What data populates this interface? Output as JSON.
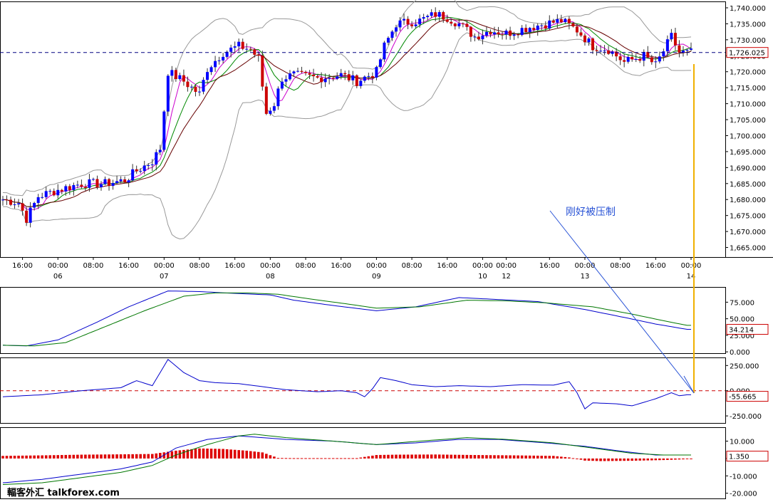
{
  "chart_data": [
    {
      "panel": "price",
      "type": "candlestick",
      "ylim": [
        1662,
        1742
      ],
      "y_ticks": [
        "1,740.000",
        "1,735.000",
        "1,730.000",
        "1,725.000",
        "1,720.000",
        "1,715.000",
        "1,710.000",
        "1,705.000",
        "1,700.000",
        "1,695.000",
        "1,690.000",
        "1,685.000",
        "1,680.000",
        "1,675.000",
        "1,670.000",
        "1,665.000"
      ],
      "y_tick_values": [
        1740,
        1735,
        1730,
        1725,
        1720,
        1715,
        1710,
        1705,
        1700,
        1695,
        1690,
        1685,
        1680,
        1675,
        1670,
        1665
      ],
      "x_ticks": [
        {
          "bar": 5,
          "time": "16:00",
          "day": ""
        },
        {
          "bar": 14,
          "time": "00:00",
          "day": "06"
        },
        {
          "bar": 23,
          "time": "08:00",
          "day": ""
        },
        {
          "bar": 32,
          "time": "16:00",
          "day": ""
        },
        {
          "bar": 41,
          "time": "00:00",
          "day": "07"
        },
        {
          "bar": 50,
          "time": "08:00",
          "day": ""
        },
        {
          "bar": 59,
          "time": "16:00",
          "day": ""
        },
        {
          "bar": 68,
          "time": "00:00",
          "day": "08"
        },
        {
          "bar": 77,
          "time": "08:00",
          "day": ""
        },
        {
          "bar": 86,
          "time": "16:00",
          "day": ""
        },
        {
          "bar": 95,
          "time": "00:00",
          "day": "09"
        },
        {
          "bar": 104,
          "time": "08:00",
          "day": ""
        },
        {
          "bar": 113,
          "time": "16:00",
          "day": ""
        },
        {
          "bar": 122,
          "time": "00:00",
          "day": "10"
        },
        {
          "bar": 128,
          "time": "00:00",
          "day": "12"
        },
        {
          "bar": 139,
          "time": "16:00",
          "day": ""
        },
        {
          "bar": 148,
          "time": "00:00",
          "day": "13"
        },
        {
          "bar": 157,
          "time": "08:00",
          "day": ""
        },
        {
          "bar": 166,
          "time": "16:00",
          "day": ""
        },
        {
          "bar": 175,
          "time": "00:00",
          "day": "14"
        }
      ],
      "current_price": 1726.025,
      "current_price_label": "1,726.025",
      "waypoints": [
        [
          0,
          1680
        ],
        [
          4,
          1679
        ],
        [
          6,
          1674
        ],
        [
          9,
          1681
        ],
        [
          14,
          1683
        ],
        [
          20,
          1685
        ],
        [
          26,
          1685
        ],
        [
          31,
          1686
        ],
        [
          34,
          1689
        ],
        [
          38,
          1692
        ],
        [
          40,
          1696
        ],
        [
          42,
          1720
        ],
        [
          46,
          1717
        ],
        [
          50,
          1713
        ],
        [
          52,
          1721
        ],
        [
          56,
          1726
        ],
        [
          60,
          1728
        ],
        [
          63,
          1727
        ],
        [
          65,
          1724
        ],
        [
          67,
          1707
        ],
        [
          69,
          1710
        ],
        [
          71,
          1718
        ],
        [
          74,
          1719
        ],
        [
          80,
          1718
        ],
        [
          86,
          1719
        ],
        [
          90,
          1717
        ],
        [
          95,
          1720
        ],
        [
          97,
          1728
        ],
        [
          100,
          1735
        ],
        [
          106,
          1736
        ],
        [
          110,
          1738
        ],
        [
          113,
          1737
        ],
        [
          116,
          1735
        ],
        [
          120,
          1731
        ],
        [
          124,
          1733
        ],
        [
          128,
          1732
        ],
        [
          134,
          1734
        ],
        [
          142,
          1736
        ],
        [
          146,
          1733
        ],
        [
          150,
          1728
        ],
        [
          154,
          1727
        ],
        [
          158,
          1723
        ],
        [
          163,
          1725
        ],
        [
          166,
          1722
        ],
        [
          170,
          1731
        ],
        [
          172,
          1726
        ]
      ],
      "bollinger_width": 12,
      "ma_colors": [
        "#cc00cc",
        "#008800",
        "#660000"
      ],
      "bollinger_color": "#999999",
      "up_color": "#0000ff",
      "down_color": "#cc0000",
      "annotation": "刚好被压制"
    },
    {
      "panel": "stochastic",
      "type": "line",
      "ylim": [
        -2,
        98
      ],
      "y_ticks": [
        "75.000",
        "50.000",
        "25.000",
        "0.000"
      ],
      "y_tick_values": [
        75,
        50,
        25,
        0
      ],
      "current_label": "34.214",
      "series": [
        {
          "color": "#0000cc",
          "points": [
            [
              0,
              10
            ],
            [
              6,
              9
            ],
            [
              14,
              18
            ],
            [
              24,
              45
            ],
            [
              32,
              68
            ],
            [
              42,
              92
            ],
            [
              50,
              91
            ],
            [
              60,
              88
            ],
            [
              68,
              86
            ],
            [
              74,
              78
            ],
            [
              84,
              70
            ],
            [
              95,
              62
            ],
            [
              105,
              68
            ],
            [
              116,
              82
            ],
            [
              126,
              79
            ],
            [
              136,
              76
            ],
            [
              148,
              64
            ],
            [
              158,
              52
            ],
            [
              166,
              42
            ],
            [
              174,
              34
            ]
          ]
        },
        {
          "color": "#007700",
          "points": [
            [
              0,
              10
            ],
            [
              8,
              9
            ],
            [
              16,
              14
            ],
            [
              26,
              38
            ],
            [
              36,
              62
            ],
            [
              46,
              84
            ],
            [
              54,
              89
            ],
            [
              62,
              89
            ],
            [
              70,
              87
            ],
            [
              78,
              80
            ],
            [
              88,
              72
            ],
            [
              95,
              66
            ],
            [
              106,
              68
            ],
            [
              118,
              78
            ],
            [
              128,
              77
            ],
            [
              138,
              74
            ],
            [
              150,
              68
            ],
            [
              160,
              57
            ],
            [
              168,
              47
            ],
            [
              174,
              40
            ]
          ]
        }
      ]
    },
    {
      "panel": "cci",
      "type": "line",
      "ylim": [
        -320,
        330
      ],
      "y_ticks": [
        "250.000",
        "0.000",
        "-250.000"
      ],
      "y_tick_values": [
        250,
        0,
        -250
      ],
      "reference_line": 0,
      "current_label": "-55.665",
      "series": [
        {
          "color": "#0000cc",
          "points": [
            [
              0,
              -60
            ],
            [
              10,
              -40
            ],
            [
              20,
              0
            ],
            [
              30,
              30
            ],
            [
              34,
              100
            ],
            [
              38,
              50
            ],
            [
              42,
              310
            ],
            [
              46,
              180
            ],
            [
              50,
              100
            ],
            [
              54,
              80
            ],
            [
              60,
              70
            ],
            [
              66,
              40
            ],
            [
              72,
              10
            ],
            [
              80,
              -10
            ],
            [
              86,
              0
            ],
            [
              90,
              -20
            ],
            [
              92,
              -60
            ],
            [
              94,
              20
            ],
            [
              96,
              130
            ],
            [
              100,
              100
            ],
            [
              104,
              60
            ],
            [
              110,
              40
            ],
            [
              116,
              50
            ],
            [
              124,
              40
            ],
            [
              132,
              60
            ],
            [
              140,
              55
            ],
            [
              144,
              90
            ],
            [
              146,
              -20
            ],
            [
              148,
              -180
            ],
            [
              150,
              -120
            ],
            [
              156,
              -130
            ],
            [
              160,
              -150
            ],
            [
              166,
              -80
            ],
            [
              170,
              -20
            ],
            [
              172,
              -50
            ],
            [
              174,
              -40
            ]
          ]
        }
      ]
    },
    {
      "panel": "macd",
      "type": "line+histogram",
      "ylim": [
        -23,
        18
      ],
      "y_ticks": [
        "10.000",
        "0.000",
        "-10.000",
        "-20.000"
      ],
      "y_tick_values": [
        10,
        0,
        -10,
        -20
      ],
      "current_label": "1.350",
      "macd_color": "#0000cc",
      "signal_color": "#007700",
      "hist_color": "#dd0000",
      "macd": [
        [
          0,
          -14
        ],
        [
          10,
          -12
        ],
        [
          20,
          -9
        ],
        [
          30,
          -6
        ],
        [
          38,
          -2
        ],
        [
          44,
          6
        ],
        [
          52,
          11
        ],
        [
          60,
          13
        ],
        [
          66,
          12
        ],
        [
          72,
          11
        ],
        [
          84,
          10
        ],
        [
          95,
          8
        ],
        [
          105,
          9
        ],
        [
          116,
          11
        ],
        [
          126,
          11
        ],
        [
          138,
          9
        ],
        [
          148,
          7
        ],
        [
          158,
          4
        ],
        [
          166,
          2
        ],
        [
          174,
          2
        ]
      ],
      "signal": [
        [
          0,
          -15
        ],
        [
          10,
          -14
        ],
        [
          20,
          -11
        ],
        [
          30,
          -8
        ],
        [
          38,
          -4
        ],
        [
          44,
          2
        ],
        [
          52,
          8
        ],
        [
          60,
          13
        ],
        [
          64,
          14
        ],
        [
          72,
          12
        ],
        [
          84,
          10
        ],
        [
          95,
          8
        ],
        [
          106,
          10
        ],
        [
          118,
          12
        ],
        [
          128,
          11
        ],
        [
          140,
          9
        ],
        [
          150,
          6
        ],
        [
          160,
          3
        ],
        [
          168,
          2
        ],
        [
          174,
          2
        ]
      ],
      "histogram": [
        [
          0,
          1.5
        ],
        [
          10,
          1.8
        ],
        [
          20,
          2.2
        ],
        [
          30,
          2.4
        ],
        [
          38,
          2.6
        ],
        [
          44,
          4.5
        ],
        [
          50,
          5.8
        ],
        [
          56,
          5.5
        ],
        [
          62,
          4.5
        ],
        [
          66,
          3.5
        ],
        [
          70,
          0.3
        ],
        [
          74,
          0.2
        ],
        [
          90,
          0.2
        ],
        [
          95,
          2.0
        ],
        [
          100,
          2.2
        ],
        [
          110,
          2.3
        ],
        [
          120,
          2.0
        ],
        [
          130,
          1.8
        ],
        [
          140,
          1.5
        ],
        [
          144,
          0.6
        ],
        [
          146,
          -0.2
        ],
        [
          148,
          -1.2
        ],
        [
          152,
          -1.5
        ],
        [
          160,
          -1.3
        ],
        [
          168,
          -0.9
        ],
        [
          174,
          -0.4
        ]
      ]
    }
  ],
  "brand": {
    "text": "輻客外汇 talkforex.com"
  }
}
